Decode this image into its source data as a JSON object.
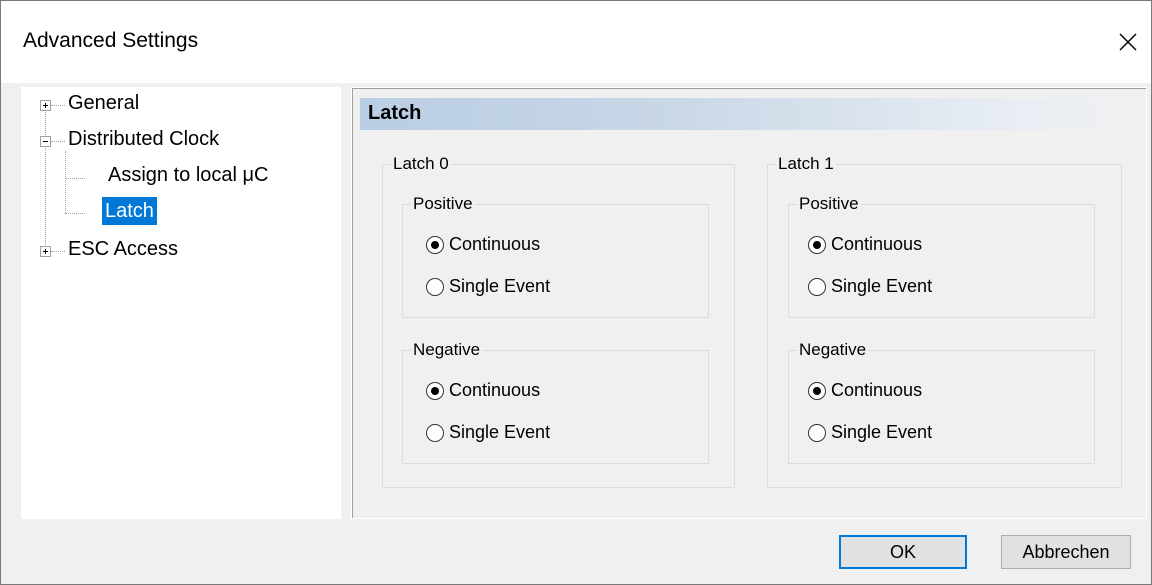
{
  "window": {
    "title": "Advanced Settings"
  },
  "tree": {
    "general": "General",
    "distributed_clock": "Distributed Clock",
    "assign_local": "Assign to local μC",
    "latch": "Latch",
    "esc_access": "ESC Access"
  },
  "panel": {
    "header": "Latch",
    "latch0": {
      "title": "Latch 0",
      "positive": {
        "title": "Positive",
        "continuous": "Continuous",
        "single": "Single Event",
        "selected": "Continuous"
      },
      "negative": {
        "title": "Negative",
        "continuous": "Continuous",
        "single": "Single Event",
        "selected": "Continuous"
      }
    },
    "latch1": {
      "title": "Latch 1",
      "positive": {
        "title": "Positive",
        "continuous": "Continuous",
        "single": "Single Event",
        "selected": "Continuous"
      },
      "negative": {
        "title": "Negative",
        "continuous": "Continuous",
        "single": "Single Event",
        "selected": "Continuous"
      }
    }
  },
  "buttons": {
    "ok": "OK",
    "cancel": "Abbrechen"
  },
  "colors": {
    "selection": "#0078d7",
    "header_gradient_start": "#b9cde4"
  }
}
